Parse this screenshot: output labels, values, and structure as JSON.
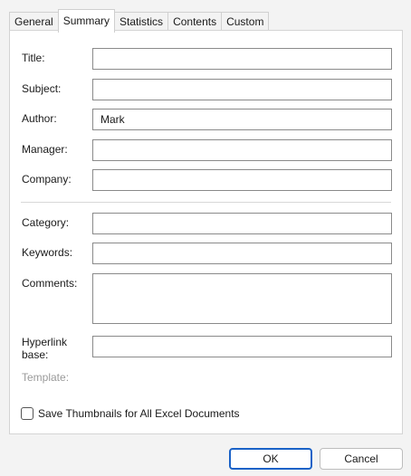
{
  "tabs": [
    {
      "label": "General"
    },
    {
      "label": "Summary"
    },
    {
      "label": "Statistics"
    },
    {
      "label": "Contents"
    },
    {
      "label": "Custom"
    }
  ],
  "active_tab": "Summary",
  "fields": {
    "title": {
      "label": "Title:",
      "value": ""
    },
    "subject": {
      "label": "Subject:",
      "value": ""
    },
    "author": {
      "label": "Author:",
      "value": "Mark"
    },
    "manager": {
      "label": "Manager:",
      "value": ""
    },
    "company": {
      "label": "Company:",
      "value": ""
    },
    "category": {
      "label": "Category:",
      "value": ""
    },
    "keywords": {
      "label": "Keywords:",
      "value": ""
    },
    "comments": {
      "label": "Comments:",
      "value": ""
    },
    "hyperlink_base": {
      "label_line1": "Hyperlink",
      "label_line2": "base:",
      "value": ""
    },
    "template": {
      "label": "Template:",
      "value": ""
    }
  },
  "thumbnail_checkbox": {
    "label": "Save Thumbnails for All Excel Documents",
    "checked": false
  },
  "buttons": {
    "ok": "OK",
    "cancel": "Cancel"
  },
  "colors": {
    "accent": "#1a62c7",
    "dialog_bg": "#f3f3f3",
    "panel_bg": "#ffffff"
  }
}
